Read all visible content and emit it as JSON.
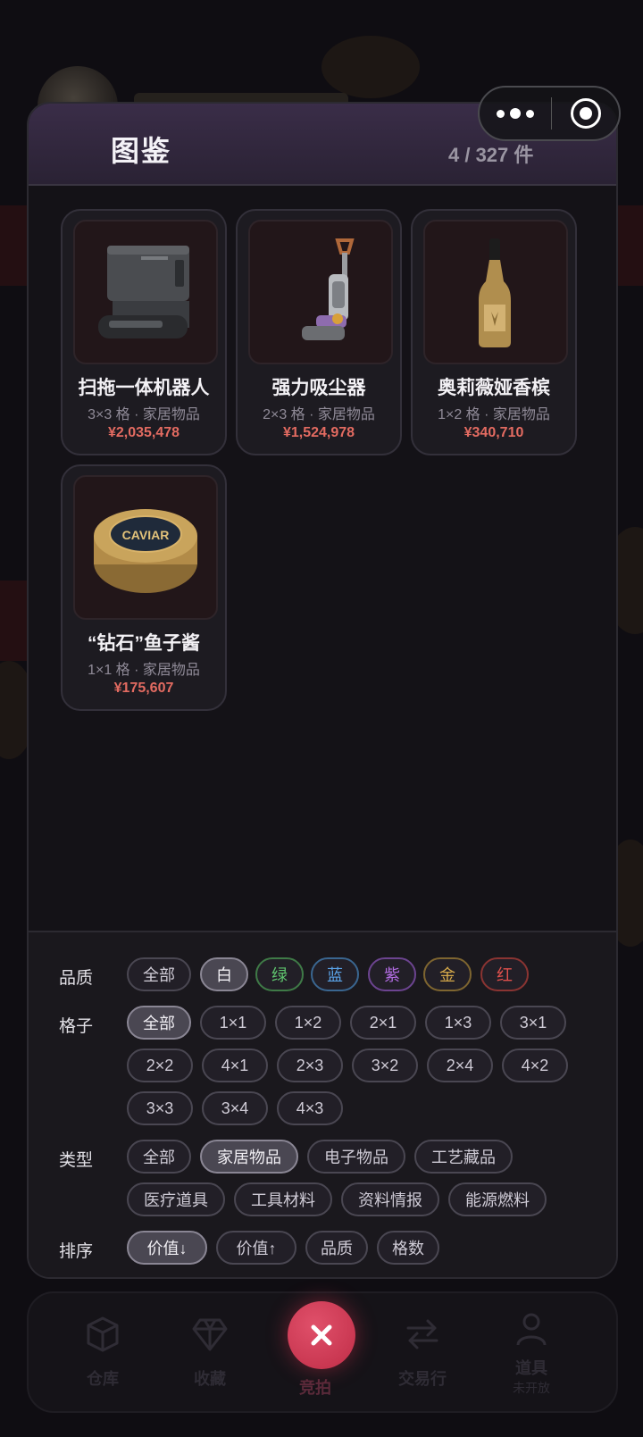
{
  "header": {
    "title": "图鉴",
    "count": "4 / 327 件"
  },
  "items": [
    {
      "name": "扫拖一体机器人",
      "meta": "3×3 格 · 家居物品",
      "price": "¥2,035,478",
      "icon": "robot-vacuum-icon"
    },
    {
      "name": "强力吸尘器",
      "meta": "2×3 格 · 家居物品",
      "price": "¥1,524,978",
      "icon": "vacuum-cleaner-icon"
    },
    {
      "name": "奥莉薇娅香槟",
      "meta": "1×2 格 · 家居物品",
      "price": "¥340,710",
      "icon": "champagne-bottle-icon"
    },
    {
      "name": "“钻石”鱼子酱",
      "meta": "1×1 格 · 家居物品",
      "price": "¥175,607",
      "icon": "caviar-tin-icon",
      "icon_text": "CAVIAR"
    }
  ],
  "filters": {
    "quality": {
      "label": "品质",
      "options": [
        "全部",
        "白",
        "绿",
        "蓝",
        "紫",
        "金",
        "红"
      ],
      "selected": "白",
      "colors": {
        "全部": "#cfcbd6",
        "白": "#e6e4e9",
        "绿": "#5fc46e",
        "蓝": "#5aa3e8",
        "紫": "#b06be0",
        "金": "#d4a84a",
        "红": "#e0504c"
      }
    },
    "grid": {
      "label": "格子",
      "options": [
        "全部",
        "1×1",
        "1×2",
        "2×1",
        "1×3",
        "3×1",
        "2×2",
        "4×1",
        "2×3",
        "3×2",
        "2×4",
        "4×2",
        "3×3",
        "3×4",
        "4×3"
      ],
      "selected": "全部"
    },
    "type": {
      "label": "类型",
      "options": [
        "全部",
        "家居物品",
        "电子物品",
        "工艺藏品",
        "医疗道具",
        "工具材料",
        "资料情报",
        "能源燃料"
      ],
      "selected": "家居物品"
    },
    "sort": {
      "label": "排序",
      "options": [
        "价值↓",
        "价值↑",
        "品质",
        "格数"
      ],
      "selected": "价值↓"
    }
  },
  "bottom_nav": {
    "items": [
      {
        "label": "仓库",
        "icon": "box-icon"
      },
      {
        "label": "收藏",
        "icon": "diamond-icon"
      },
      {
        "label": "竞拍",
        "icon": "close-icon"
      },
      {
        "label": "交易行",
        "icon": "swap-icon"
      },
      {
        "label": "道具",
        "sub": "未开放",
        "icon": "person-icon"
      }
    ]
  },
  "accent_color": "#e36b61"
}
